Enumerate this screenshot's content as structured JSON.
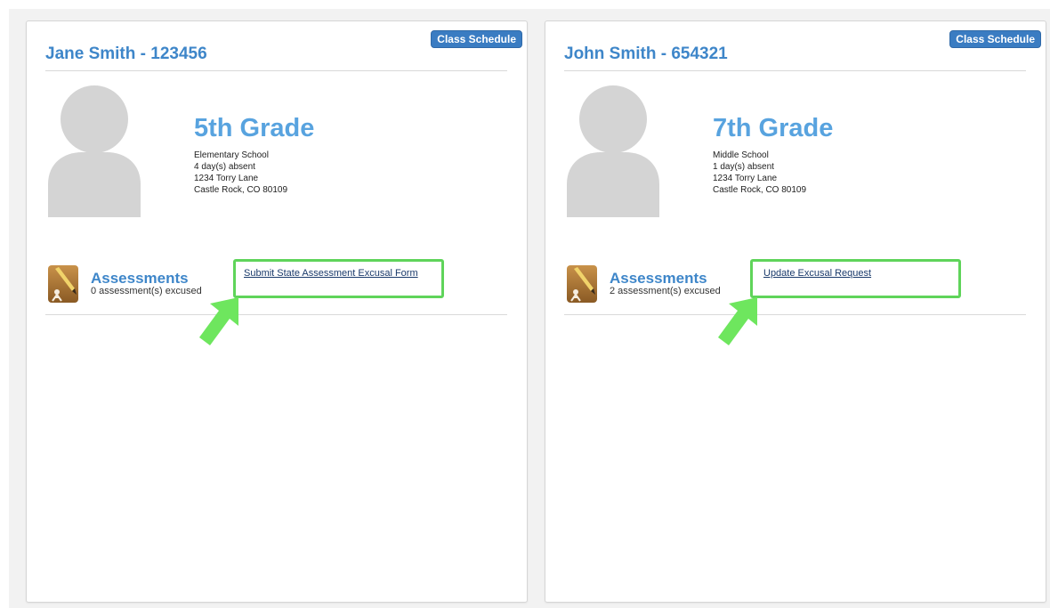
{
  "students": [
    {
      "name": "Jane Smith - 123456",
      "class_schedule_label": "Class Schedule",
      "grade": "5th Grade",
      "school": "Elementary School",
      "absences": "4 day(s) absent",
      "address_line1": "1234 Torry Lane",
      "address_line2": "Castle Rock, CO 80109",
      "assessments_title": "Assessments",
      "assessments_count": "0 assessment(s) excused",
      "action_link": "Submit State Assessment Excusal Form"
    },
    {
      "name": "John Smith - 654321",
      "class_schedule_label": "Class Schedule",
      "grade": "7th Grade",
      "school": "Middle School",
      "absences": "1 day(s) absent",
      "address_line1": "1234 Torry Lane",
      "address_line2": "Castle Rock, CO 80109",
      "assessments_title": "Assessments",
      "assessments_count": "2 assessment(s) excused",
      "action_link": "Update Excusal Request"
    }
  ],
  "colors": {
    "title_blue": "#3e86c9",
    "grade_blue": "#58a3df",
    "button_blue": "#3a7cc2",
    "highlight_green": "#5fd45a",
    "arrow_green": "#6ee65e",
    "avatar_gray": "#d4d4d4"
  },
  "icons": {
    "avatar": "person-silhouette-icon",
    "assessments": "pencil-paper-icon",
    "callout": "arrow-pointer-icon"
  }
}
